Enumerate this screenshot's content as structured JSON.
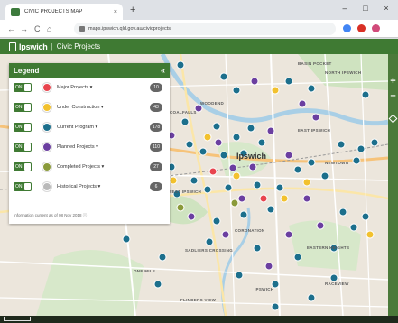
{
  "browser": {
    "tab_title": "CIVIC PROJECTS MAP",
    "tab_close": "×",
    "new_tab": "+",
    "url": "maps.ipswich.qld.gov.au/civicprojects",
    "back": "←",
    "forward": "→",
    "reload": "C",
    "home": "⌂",
    "minimize": "–",
    "maximize": "□",
    "close": "×"
  },
  "header": {
    "logo": "Ipswich",
    "separator": "|",
    "title": "Civic Projects"
  },
  "legend": {
    "title": "Legend",
    "collapse": "«",
    "items": [
      {
        "toggle": "ON",
        "label": "Major Projects ▾",
        "count": "10",
        "color": "#e8444e",
        "icon": "major-projects-icon"
      },
      {
        "toggle": "ON",
        "label": "Under Construction ▾",
        "count": "43",
        "color": "#f2c12e",
        "icon": "under-construction-icon"
      },
      {
        "toggle": "ON",
        "label": "Current Program ▾",
        "count": "178",
        "color": "#1c6f8c",
        "icon": "current-program-icon"
      },
      {
        "toggle": "ON",
        "label": "Planned Projects ▾",
        "count": "110",
        "color": "#6b3fa0",
        "icon": "planned-projects-icon"
      },
      {
        "toggle": "ON",
        "label": "Completed Projects ▾",
        "count": "27",
        "color": "#8a9a3a",
        "icon": "completed-projects-icon"
      },
      {
        "toggle": "ON",
        "label": "Historical Projects ▾",
        "count": "6",
        "color": "#b9b9b9",
        "icon": "historical-projects-icon"
      }
    ],
    "footer": "Information current as of 08 Nov 2018 ⓘ"
  },
  "map": {
    "labels": [
      "BASIN POCKET",
      "NORTH IPSWICH",
      "WOODEND",
      "EAST IPSWICH",
      "NEWTOWN",
      "WEST IPSWICH",
      "CORONATION",
      "SADLIERS CROSSING",
      "EASTERN HEIGHTS",
      "COALFALLS",
      "RACEVIEW",
      "ONE MILE",
      "IPSWICH",
      "FLINDERS VIEW"
    ],
    "city": "Ipswich",
    "zoom_in": "+",
    "zoom_out": "–"
  },
  "colors": {
    "brand": "#3f7a33",
    "current": "#1c6f8c",
    "planned": "#6b3fa0",
    "construction": "#f2c12e",
    "major": "#e8444e"
  }
}
